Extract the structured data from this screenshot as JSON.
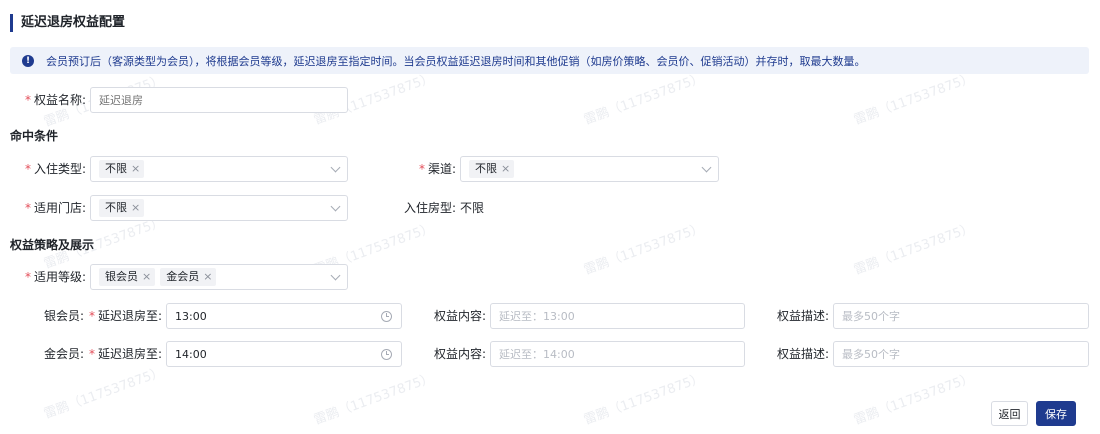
{
  "page": {
    "title": "延迟退房权益配置",
    "notice": "会员预订后（客源类型为会员），将根据会员等级，延迟退房至指定时间。当会员权益延迟退房时间和其他促销（如房价策略、会员价、促销活动）并存时，取最大数量。"
  },
  "form": {
    "required_mark": "*",
    "benefit_name": {
      "label": "权益名称:",
      "placeholder": "延迟退房"
    }
  },
  "conditions": {
    "heading": "命中条件",
    "checkin_type": {
      "label": "入住类型:",
      "tag": "不限"
    },
    "channel": {
      "label": "渠道:",
      "tag": "不限"
    },
    "store": {
      "label": "适用门店:",
      "tag": "不限"
    },
    "room_type": {
      "label": "入住房型:",
      "value": "不限"
    }
  },
  "strategy": {
    "heading": "权益策略及展示",
    "levels": {
      "label": "适用等级:",
      "tags": [
        "银会员",
        "金会员"
      ]
    },
    "rows": [
      {
        "level": "银会员:",
        "delay_label": "延迟退房至:",
        "time": "13:00",
        "content_label": "权益内容:",
        "content_placeholder": "延迟至：13:00",
        "desc_label": "权益描述:",
        "desc_placeholder": "最多50个字"
      },
      {
        "level": "金会员:",
        "delay_label": "延迟退房至:",
        "time": "14:00",
        "content_label": "权益内容:",
        "content_placeholder": "延迟至：14:00",
        "desc_label": "权益描述:",
        "desc_placeholder": "最多50个字"
      }
    ]
  },
  "tag_close": "×",
  "info_glyph": "!",
  "buttons": {
    "back": "返回",
    "save": "保存"
  },
  "watermark": "雷鹏（117537875）",
  "colors": {
    "primary": "#1f3b8f",
    "required": "#e34d59",
    "notice_bg": "#eef2fa"
  },
  "icons": [
    "info-icon",
    "chevron-down-icon",
    "clock-icon",
    "close-icon"
  ]
}
